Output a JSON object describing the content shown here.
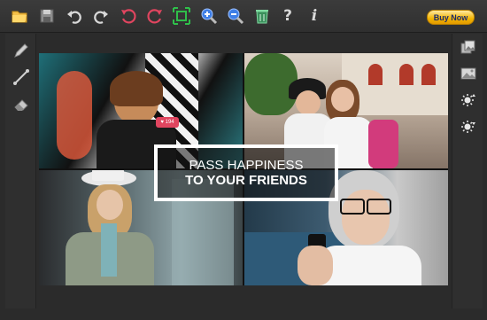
{
  "toolbar": {
    "items": [
      {
        "name": "open-folder-icon"
      },
      {
        "name": "save-icon"
      },
      {
        "name": "undo-icon"
      },
      {
        "name": "redo-icon"
      },
      {
        "name": "rotate-left-icon"
      },
      {
        "name": "rotate-right-icon"
      },
      {
        "name": "fit-to-window-icon"
      },
      {
        "name": "zoom-in-icon"
      },
      {
        "name": "zoom-out-icon"
      },
      {
        "name": "delete-icon"
      },
      {
        "name": "help-icon",
        "glyph": "?"
      },
      {
        "name": "info-icon",
        "glyph": "i"
      }
    ],
    "buy_now_label": "Buy Now"
  },
  "left_tools": [
    {
      "name": "pencil-icon"
    },
    {
      "name": "line-icon"
    },
    {
      "name": "eraser-icon"
    }
  ],
  "right_tools": [
    {
      "name": "photos-icon"
    },
    {
      "name": "image-library-icon"
    },
    {
      "name": "brightness-up-icon"
    },
    {
      "name": "brightness-down-icon"
    }
  ],
  "canvas": {
    "overlay_line1": "PASS HAPPINESS",
    "overlay_line2": "TO YOUR FRIENDS",
    "like_badge": "♥ 194"
  },
  "colors": {
    "toolbar_bg": "#333333",
    "accent_red": "#e0455f",
    "accent_green": "#2fbf4a",
    "accent_blue": "#3f7fe6",
    "buy_gold": "#f2b400"
  }
}
